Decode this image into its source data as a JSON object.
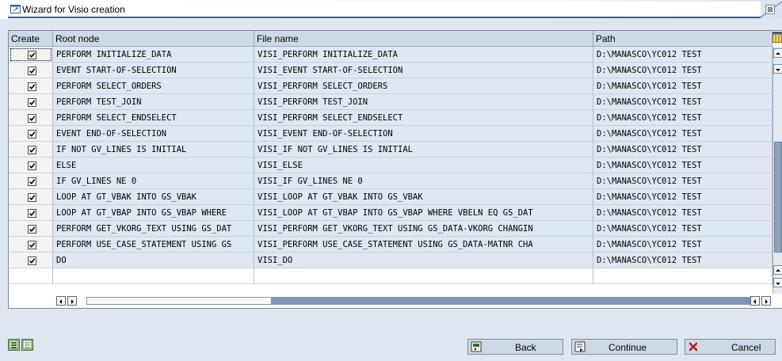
{
  "window": {
    "title": "Wizard for Visio creation",
    "close_glyph": "⊠"
  },
  "table": {
    "columns": [
      "Create",
      "Root node",
      "File name",
      "Path"
    ],
    "rows": [
      {
        "create": true,
        "root": "PERFORM INITIALIZE_DATA",
        "file": "VISI_PERFORM INITIALIZE_DATA",
        "path": "D:\\MANASCO\\YC012 TEST"
      },
      {
        "create": true,
        "root": "EVENT START-OF-SELECTION",
        "file": "VISI_EVENT START-OF-SELECTION",
        "path": "D:\\MANASCO\\YC012 TEST"
      },
      {
        "create": true,
        "root": "PERFORM SELECT_ORDERS",
        "file": "VISI_PERFORM SELECT_ORDERS",
        "path": "D:\\MANASCO\\YC012 TEST"
      },
      {
        "create": true,
        "root": "PERFORM TEST_JOIN",
        "file": "VISI_PERFORM TEST_JOIN",
        "path": "D:\\MANASCO\\YC012 TEST"
      },
      {
        "create": true,
        "root": "PERFORM SELECT_ENDSELECT",
        "file": "VISI_PERFORM SELECT_ENDSELECT",
        "path": "D:\\MANASCO\\YC012 TEST"
      },
      {
        "create": true,
        "root": "EVENT END-OF-SELECTION",
        "file": "VISI_EVENT END-OF-SELECTION",
        "path": "D:\\MANASCO\\YC012 TEST"
      },
      {
        "create": true,
        "root": "IF NOT GV_LINES IS INITIAL",
        "file": "VISI_IF NOT GV_LINES IS INITIAL",
        "path": "D:\\MANASCO\\YC012 TEST"
      },
      {
        "create": true,
        "root": "ELSE",
        "file": "VISI_ELSE",
        "path": "D:\\MANASCO\\YC012 TEST"
      },
      {
        "create": true,
        "root": "IF GV_LINES NE 0",
        "file": "VISI_IF GV_LINES NE 0",
        "path": "D:\\MANASCO\\YC012 TEST"
      },
      {
        "create": true,
        "root": "LOOP AT GT_VBAK INTO GS_VBAK",
        "file": "VISI_LOOP AT GT_VBAK INTO GS_VBAK",
        "path": "D:\\MANASCO\\YC012 TEST"
      },
      {
        "create": true,
        "root": "LOOP AT GT_VBAP INTO GS_VBAP WHERE",
        "file": "VISI_LOOP AT GT_VBAP INTO GS_VBAP WHERE VBELN EQ GS_DAT",
        "path": "D:\\MANASCO\\YC012 TEST"
      },
      {
        "create": true,
        "root": "PERFORM GET_VKORG_TEXT USING GS_DAT",
        "file": "VISI_PERFORM GET_VKORG_TEXT USING GS_DATA-VKORG CHANGIN",
        "path": "D:\\MANASCO\\YC012 TEST"
      },
      {
        "create": true,
        "root": "PERFORM USE_CASE_STATEMENT USING GS",
        "file": "VISI_PERFORM USE_CASE_STATEMENT USING GS_DATA-MATNR CHA",
        "path": "D:\\MANASCO\\YC012 TEST"
      },
      {
        "create": true,
        "root": "DO",
        "file": "VISI_DO",
        "path": "D:\\MANASCO\\YC012 TEST"
      },
      {
        "create": false,
        "root": "",
        "file": "",
        "path": ""
      }
    ]
  },
  "buttons": {
    "back": "Back",
    "continue": "Continue",
    "cancel": "Cancel"
  },
  "colors": {
    "title_bar": "#7790b4",
    "title_bar_light": "#ffffff",
    "header_bg": "#cfd9e6",
    "row_alt": "#dfe7f3",
    "cancel_icon": "#c0171c"
  },
  "icons": {
    "title": "wizard-window-icon",
    "back": "back-icon",
    "continue": "continue-icon",
    "cancel": "cancel-x-icon",
    "tool1": "select-all-icon",
    "tool2": "deselect-all-icon"
  }
}
